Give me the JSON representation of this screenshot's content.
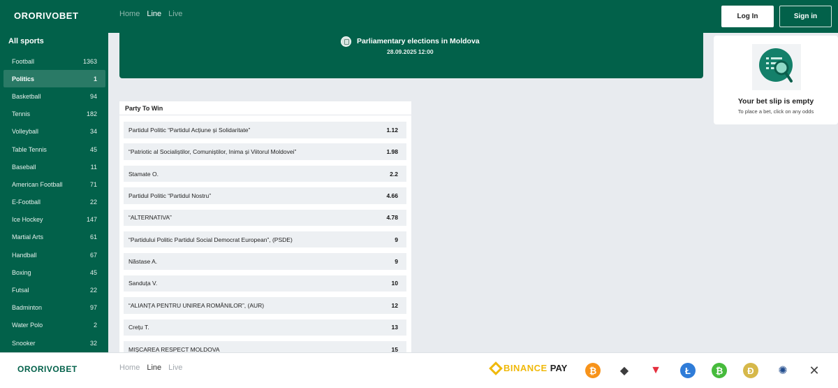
{
  "header": {
    "logo": "ORORIVOBET",
    "nav": [
      "Home",
      "Line",
      "Live"
    ],
    "active_nav": "Line",
    "login_label": "Log In",
    "signin_label": "Sign in"
  },
  "sidebar": {
    "title": "All sports",
    "items": [
      {
        "label": "Football",
        "count": "1363"
      },
      {
        "label": "Politics",
        "count": "1",
        "active": true
      },
      {
        "label": "Basketball",
        "count": "94"
      },
      {
        "label": "Tennis",
        "count": "182"
      },
      {
        "label": "Volleyball",
        "count": "34"
      },
      {
        "label": "Table Tennis",
        "count": "45"
      },
      {
        "label": "Baseball",
        "count": "11"
      },
      {
        "label": "American Football",
        "count": "71"
      },
      {
        "label": "E-Football",
        "count": "22"
      },
      {
        "label": "Ice Hockey",
        "count": "147"
      },
      {
        "label": "Martial Arts",
        "count": "61"
      },
      {
        "label": "Handball",
        "count": "67"
      },
      {
        "label": "Boxing",
        "count": "45"
      },
      {
        "label": "Futsal",
        "count": "22"
      },
      {
        "label": "Badminton",
        "count": "97"
      },
      {
        "label": "Water Polo",
        "count": "2"
      },
      {
        "label": "Snooker",
        "count": "32"
      }
    ]
  },
  "event": {
    "title": "Parliamentary elections in Moldova",
    "date": "28.09.2025 12:00"
  },
  "market": {
    "title": "Party To Win",
    "outcomes": [
      {
        "name": "Partidul Politic “Partidul Acțiune și Solidaritate”",
        "odds": "1.12"
      },
      {
        "name": "“Patriotic al Socialiștilor, Comuniștilor, Inima și Viitorul Moldovei”",
        "odds": "1.98"
      },
      {
        "name": "Stamate O.",
        "odds": "2.2"
      },
      {
        "name": "Partidul Politic “Partidul Nostru”",
        "odds": "4.66"
      },
      {
        "name": "“ALTERNATIVA”",
        "odds": "4.78"
      },
      {
        "name": "“Partidului Politic Partidul Social Democrat European”, (PSDE)",
        "odds": "9"
      },
      {
        "name": "Năstase A.",
        "odds": "9"
      },
      {
        "name": "Sanduța V.",
        "odds": "10"
      },
      {
        "name": "“ALIANȚA PENTRU UNIREA ROMÂNILOR”, (AUR)",
        "odds": "12"
      },
      {
        "name": "Crețu T.",
        "odds": "13"
      },
      {
        "name": "MIȘCAREA RESPECT MOLDOVA",
        "odds": "15"
      }
    ]
  },
  "betslip": {
    "title": "Your bet slip is empty",
    "text": "To place a bet, click on any odds",
    "icon": "search-list-icon"
  },
  "footer": {
    "logo": "ORORIVOBET",
    "nav": [
      "Home",
      "Line",
      "Live"
    ],
    "active_nav": "Line",
    "binance_name": "BINANCE",
    "binance_pay": "PAY",
    "crypto_icons": [
      {
        "name": "bitcoin-icon",
        "glyph": "₿",
        "color": "#f7931a"
      },
      {
        "name": "ethereum-icon",
        "glyph": "◆",
        "color": "#3c3c3d"
      },
      {
        "name": "tron-icon",
        "glyph": "▼",
        "color": "#e5303f"
      },
      {
        "name": "litecoin-icon",
        "glyph": "Ł",
        "color": "#2f7cd8"
      },
      {
        "name": "bitcoin-cash-icon",
        "glyph": "₿",
        "color": "#46bb3c"
      },
      {
        "name": "dogecoin-icon",
        "glyph": "Ð",
        "color": "#d6b84a"
      },
      {
        "name": "cardano-icon",
        "glyph": "✺",
        "color": "#1e4a8c"
      },
      {
        "name": "xrp-icon",
        "glyph": "✕",
        "color": "#444444"
      }
    ]
  },
  "colors": {
    "brand_green": "#02614a",
    "active_item": "#2a7a66",
    "page_bg": "#e8ebef"
  }
}
